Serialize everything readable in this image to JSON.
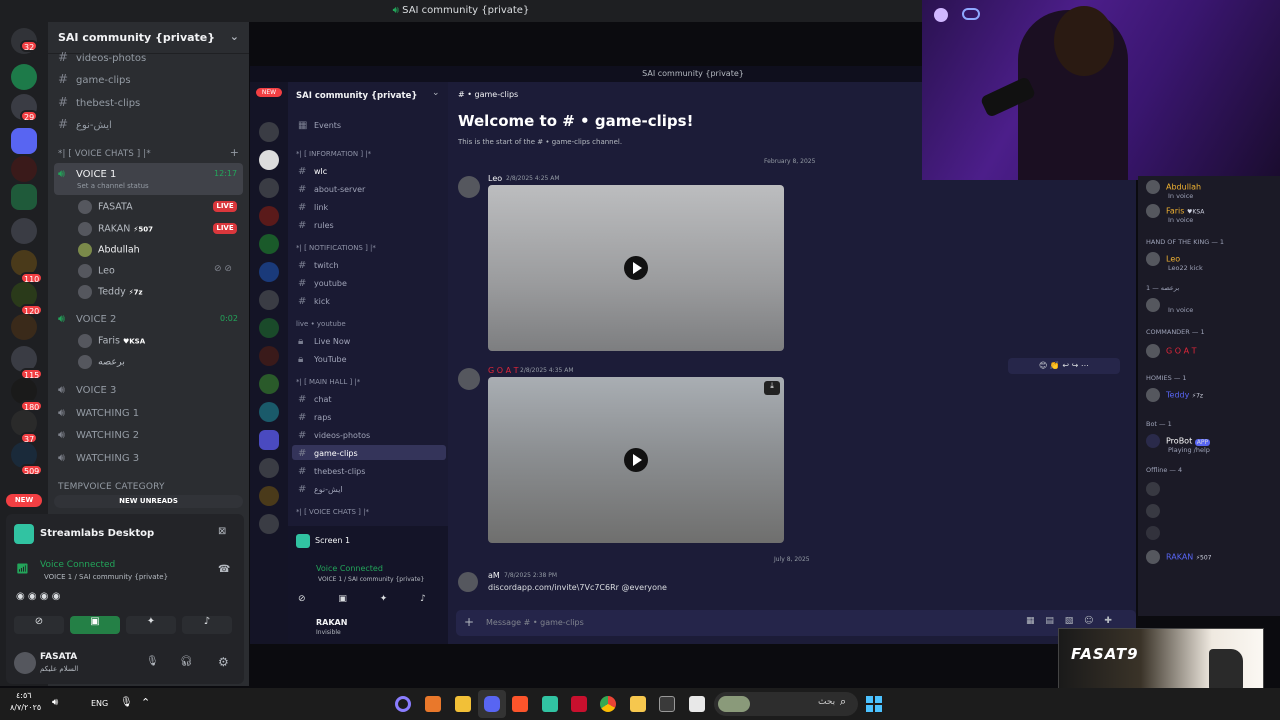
{
  "window": {
    "title": "SAI community {private}"
  },
  "rail": {
    "badges": [
      "32",
      "29",
      "110",
      "120",
      "115",
      "180",
      "37",
      "509"
    ],
    "new_label": "NEW"
  },
  "sidebar": {
    "server_name": "SAI community {private}",
    "top_channels": [
      "videos-photos",
      "game-clips",
      "thebest-clips",
      "ايش-نوع"
    ],
    "voice_category": "*| [ VOICE CHATS ] |*",
    "voice1": {
      "name": "VOICE 1",
      "timer": "12:17",
      "status": "Set a channel status",
      "users": [
        {
          "name": "FASATA",
          "live": "LIVE"
        },
        {
          "name": "RAKAN",
          "tag": "507",
          "live": "LIVE"
        },
        {
          "name": "Abdullah"
        },
        {
          "name": "Leo"
        },
        {
          "name": "Teddy",
          "tag": "7z"
        }
      ]
    },
    "voice2": {
      "name": "VOICE 2",
      "timer": "0:02",
      "users": [
        {
          "name": "Faris",
          "tag": "KSA"
        },
        {
          "name": "برعصه"
        }
      ]
    },
    "other_voice": [
      "VOICE 3",
      "WATCHING 1",
      "WATCHING 2",
      "WATCHING 3"
    ],
    "temp_category": "TEMPVOICE CATEGORY",
    "new_unreads": "NEW UNREADS"
  },
  "streamlabs": {
    "title": "Streamlabs Desktop",
    "voice_status": "Voice Connected",
    "voice_location": "VOICE 1 / SAI community {private}",
    "user": "FASATA",
    "user_status": "السلام عليكم"
  },
  "capture": {
    "topbar": "SAI community {private}",
    "server_name": "SAI community {private}",
    "events": "Events",
    "cat_info": "*| [ INFORMATION ] |*",
    "info_channels": [
      "wlc",
      "about-server",
      "link",
      "rules"
    ],
    "cat_notif": "*| [ NOTIFICATIONS ] |*",
    "notif_channels": [
      "twitch",
      "youtube",
      "kick"
    ],
    "cat_live": "live • youtube",
    "live_channels": [
      "Live Now",
      "YouTube"
    ],
    "cat_main": "*| [ MAIN HALL ] |*",
    "main_channels": [
      "chat",
      "raps",
      "videos-photos",
      "game-clips",
      "thebest-clips",
      "ايش-نوع"
    ],
    "cat_voice": "*| [ VOICE CHATS ] |*",
    "screen_label": "Screen 1",
    "voice_status": "Voice Connected",
    "voice_location": "VOICE 1 / SAI community {private}",
    "user": "RAKAN",
    "user_status": "Invisible",
    "channel_header": "game-clips",
    "welcome": "Welcome to # • game-clips!",
    "welcome_sub": "This is the start of the # • game-clips channel.",
    "date1": "February 8, 2025",
    "msg1": {
      "author": "Leo",
      "time": "2/8/2025 4:25 AM"
    },
    "msg2": {
      "author": "G O A T",
      "time": "2/8/2025 4:35 AM"
    },
    "date2": "July 8, 2025",
    "msg3": {
      "author": "aM",
      "time": "7/8/2025 2:38 PM",
      "text": "discordapp.com/invite\\7Vc7C6Rr @everyone"
    },
    "input_placeholder": "Message # • game-clips"
  },
  "members": {
    "rows1": [
      {
        "name": "Abdullah",
        "sub": "In voice"
      },
      {
        "name": "Faris",
        "tag": "KSA",
        "sub": "In voice"
      }
    ],
    "cat_hand": "HAND OF THE KING — 1",
    "leo": {
      "name": "Leo",
      "sub": "Leo22 kick"
    },
    "cat_2": "برعصه — 1",
    "sub_2": "In voice",
    "cat_commander": "COMMANDER — 1",
    "goat": "G O A T",
    "cat_homies": "HOMIES — 1",
    "teddy": {
      "name": "Teddy",
      "tag": "7z"
    },
    "cat_bot": "Bot — 1",
    "probot": {
      "name": "ProBot",
      "tag": "APP",
      "sub": "Playing /help"
    },
    "cat_offline": "Offline — 4",
    "rakan": {
      "name": "RAKAN",
      "tag": "507"
    }
  },
  "banner": {
    "title": "FASAT9"
  },
  "taskbar": {
    "lang": "ENG",
    "search": "بحث",
    "time": "٤:٥٦",
    "date": "٨/٧/٢٠٢٥"
  },
  "colors": {
    "discord_bg": "#2b2d31",
    "rail": "#1e1f22",
    "live": "#da373c",
    "green": "#23a55a",
    "accent": "#5865f2"
  }
}
